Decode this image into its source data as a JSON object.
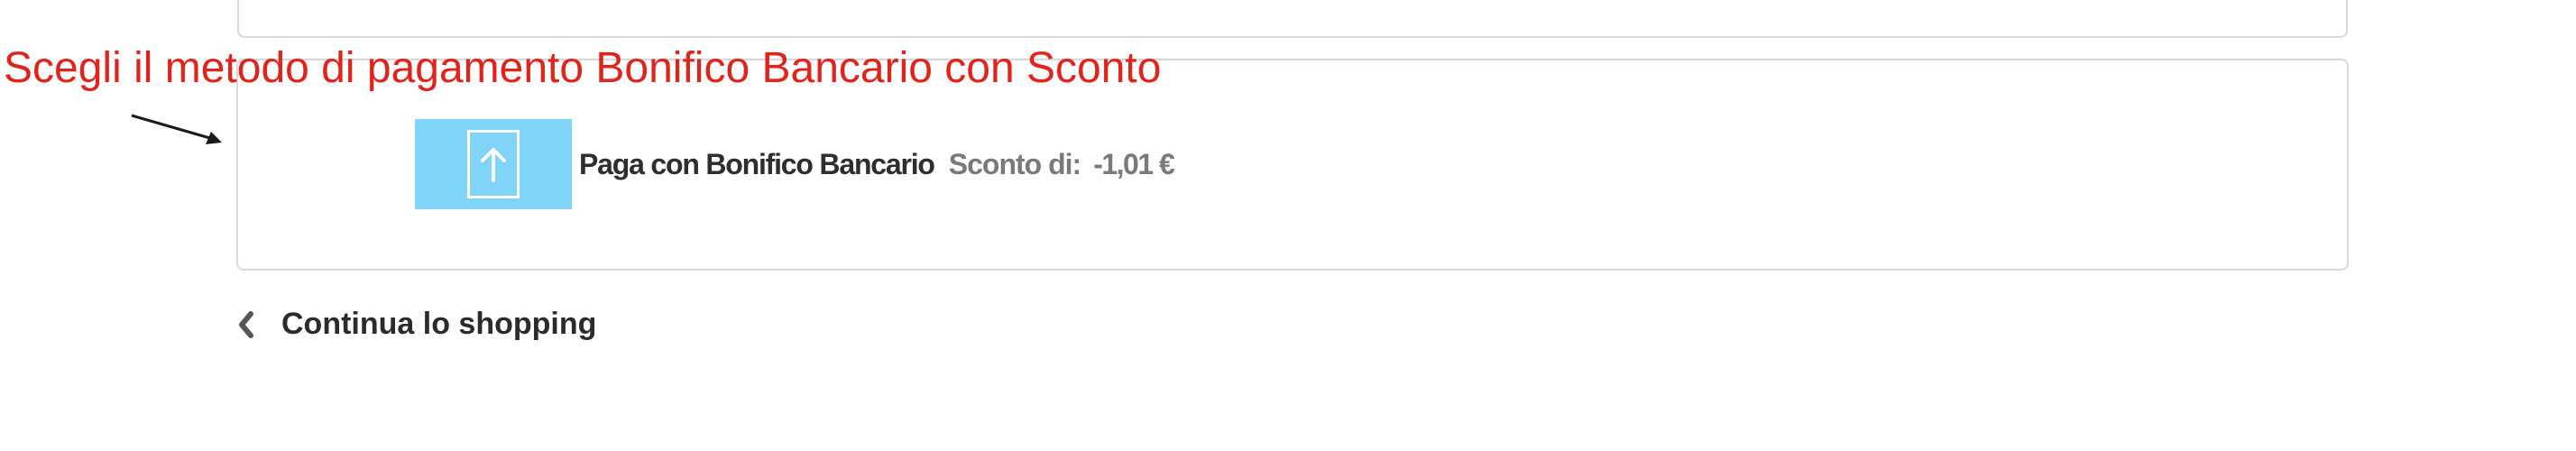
{
  "annotation": {
    "text": "Scegli il metodo di pagamento Bonifico Bancario con Sconto",
    "color": "#e0241b"
  },
  "payment_option": {
    "label": "Paga con Bonifico Bancario",
    "discount_label": "Sconto di:",
    "discount_value": "-1,01 €",
    "icon": "upload-arrow-icon",
    "icon_bg": "#7fd4f7"
  },
  "continue_link": {
    "label": "Continua lo shopping",
    "icon": "chevron-left-icon"
  }
}
